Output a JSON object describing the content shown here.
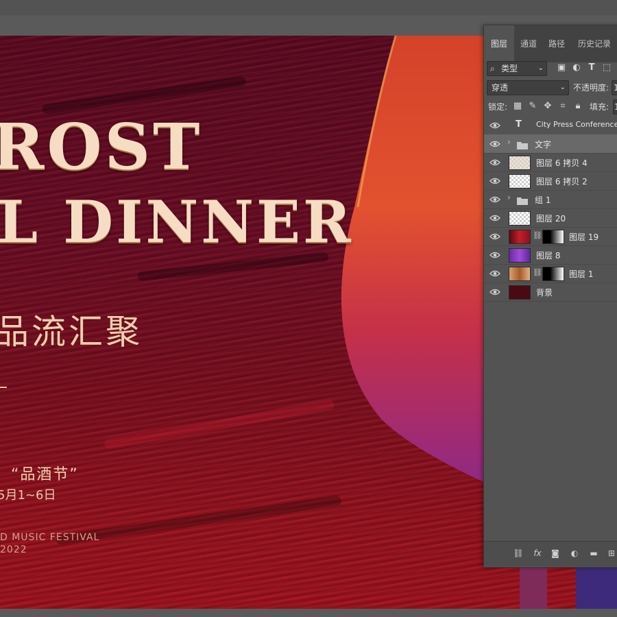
{
  "poster": {
    "title_line1": "ROST",
    "title_line2": "L DINNER",
    "cn_title": "品流汇聚",
    "festival": "“品酒节”",
    "date": "5月1~6日",
    "en_subtitle": "D MUSIC FESTIVAL",
    "year": "2022"
  },
  "panel": {
    "tabs": [
      "图层",
      "通道",
      "路径",
      "历史记录"
    ],
    "filter_kind": "类型",
    "blend_mode": "穿透",
    "opacity_label": "不透明度:",
    "opacity_value": "1",
    "lock_label": "锁定:",
    "fill_label": "填充:",
    "fill_value": "1",
    "layers": [
      {
        "name": "City Press Conference a",
        "type": "text"
      },
      {
        "name": "文字",
        "type": "group",
        "selected": true
      },
      {
        "name": "图层 6 拷贝 4",
        "type": "image"
      },
      {
        "name": "图层 6 拷贝 2",
        "type": "image"
      },
      {
        "name": "组 1",
        "type": "group"
      },
      {
        "name": "图层 20",
        "type": "empty"
      },
      {
        "name": "图层 19",
        "type": "masked"
      },
      {
        "name": "图层 8",
        "type": "image"
      },
      {
        "name": "图层 1",
        "type": "masked"
      },
      {
        "name": "背景",
        "type": "background"
      }
    ],
    "bottom_icons": [
      "link-icon",
      "fx-icon",
      "mask-icon",
      "adjustment-icon",
      "folder-icon",
      "new-layer-icon"
    ],
    "fx_label": "fx"
  },
  "colors": {
    "workspace": "#535353",
    "poster_red": "#7c1020",
    "gold_text": "#f6dcc2",
    "panel_bg": "#535353",
    "selected_layer": "#696969"
  }
}
